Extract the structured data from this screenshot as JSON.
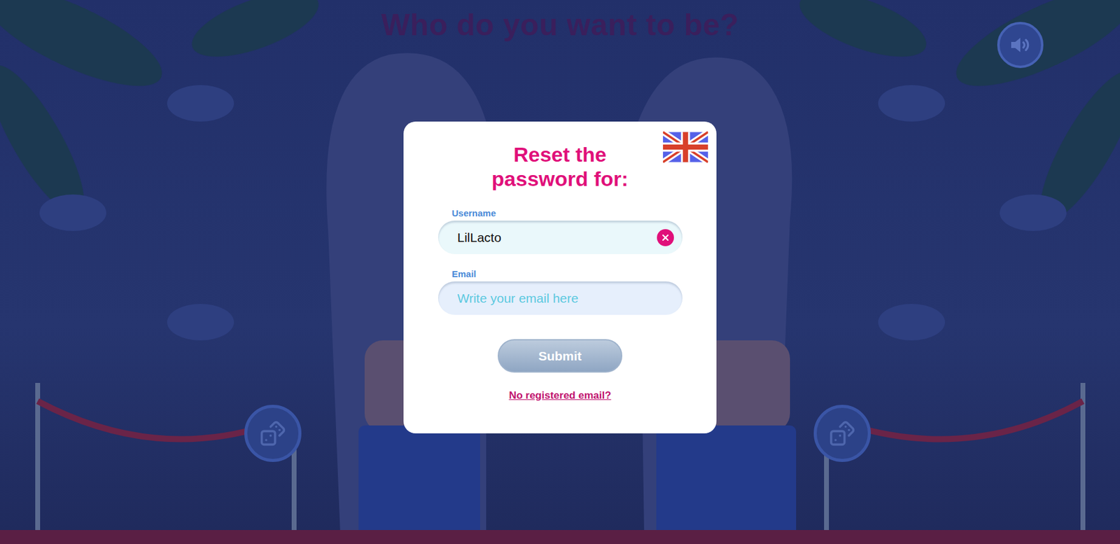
{
  "screen": {
    "title": "Who do you want to be?"
  },
  "sound": {
    "muted": false
  },
  "dialog": {
    "title": "Reset the password for:",
    "fields": [
      {
        "label": "Username",
        "value": "LilLacto",
        "placeholder": "",
        "clearable": true
      },
      {
        "label": "Email",
        "value": "",
        "placeholder": "Write your email here",
        "clearable": false
      }
    ],
    "submit": {
      "label": "Submit",
      "disabled": true
    },
    "link": "No registered email?"
  }
}
